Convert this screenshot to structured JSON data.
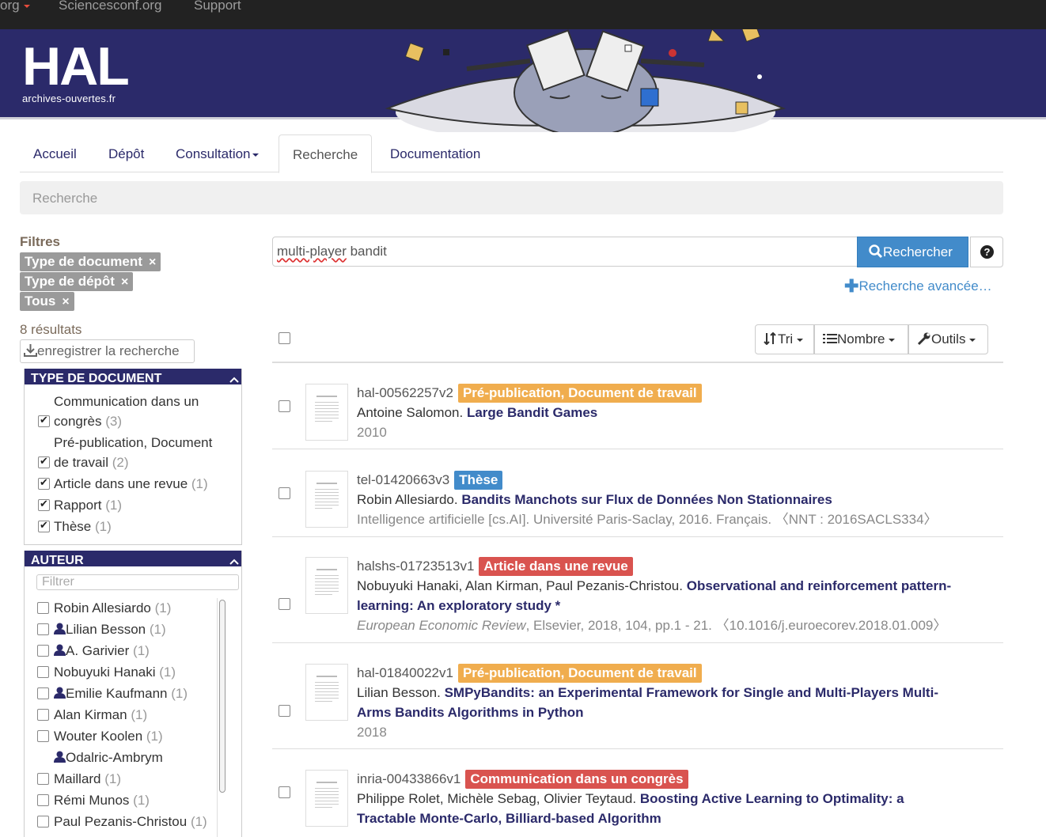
{
  "topbar": {
    "items": [
      {
        "label": "org"
      },
      {
        "label": "Sciencesconf.org"
      },
      {
        "label": "Support"
      }
    ]
  },
  "logo": {
    "title": "HAL",
    "subtitle": "archives-ouvertes.fr"
  },
  "nav": {
    "tabs": [
      {
        "label": "Accueil"
      },
      {
        "label": "Dépôt"
      },
      {
        "label": "Consultation"
      },
      {
        "label": "Recherche"
      },
      {
        "label": "Documentation"
      }
    ]
  },
  "breadcrumb": "Recherche",
  "filters": {
    "title": "Filtres",
    "tags": [
      "Type de document",
      "Type de dépôt",
      "Tous"
    ],
    "close_glyph": "×"
  },
  "results_count": "8 résultats",
  "save_search_label": "enregistrer la recherche",
  "facet_doctype": {
    "title": "TYPE DE DOCUMENT",
    "items": [
      {
        "line1": "Communication dans un",
        "line2": "congrès",
        "count": "(3)",
        "checked": true
      },
      {
        "line1": "Pré-publication, Document",
        "line2": "de travail",
        "count": "(2)",
        "checked": true
      },
      {
        "label": "Article dans une revue",
        "count": "(1)",
        "checked": true
      },
      {
        "label": "Rapport",
        "count": "(1)",
        "checked": true
      },
      {
        "label": "Thèse",
        "count": "(1)",
        "checked": true
      }
    ]
  },
  "facet_author": {
    "title": "AUTEUR",
    "filter_placeholder": "Filtrer",
    "items": [
      {
        "label": "Robin Allesiardo",
        "count": "(1)"
      },
      {
        "label": "Lilian Besson",
        "count": "(1)"
      },
      {
        "label": "A. Garivier",
        "count": "(1)"
      },
      {
        "label": "Nobuyuki Hanaki",
        "count": "(1)"
      },
      {
        "label": "Emilie Kaufmann",
        "count": "(1)"
      },
      {
        "label": "Alan Kirman",
        "count": "(1)"
      },
      {
        "label": "Wouter Koolen",
        "count": "(1)"
      },
      {
        "label": "Odalric-Ambrym",
        "count": ""
      },
      {
        "label": "Maillard",
        "count": "(1)"
      },
      {
        "label": "Rémi Munos",
        "count": "(1)"
      },
      {
        "label": "Paul Pezanis-Christou",
        "count": "(1)"
      }
    ]
  },
  "search": {
    "query_misspelled": "multi-player",
    "query_rest": " bandit",
    "button_label": "Rechercher",
    "help_glyph": "?",
    "advanced_label": "Recherche avancée…"
  },
  "toolbar": {
    "sort_label": "Tri",
    "count_label": "Nombre",
    "tools_label": "Outils"
  },
  "colors": {
    "hal_blue": "#2b2a6a",
    "orange": "#f0ad4e",
    "blue": "#428bca",
    "red": "#d9534f"
  },
  "results": [
    {
      "docid": "hal-00562257v2",
      "badge": "Pré-publication, Document de travail",
      "badge_color": "#f0ad4e",
      "authors": "Antoine Salomon.",
      "title": "Large Bandit Games",
      "meta": "2010"
    },
    {
      "docid": "tel-01420663v3",
      "badge": "Thèse",
      "badge_color": "#428bca",
      "authors": "Robin Allesiardo.",
      "title": "Bandits Manchots sur Flux de Données Non Stationnaires",
      "meta_plain": "Intelligence artificielle [cs.AI]. Université Paris-Saclay, 2016. Français.",
      "meta_link": "〈NNT : 2016SACLS334〉"
    },
    {
      "docid": "halshs-01723513v1",
      "badge": "Article dans une revue",
      "badge_color": "#d9534f",
      "authors": "Nobuyuki Hanaki, Alan Kirman, Paul Pezanis-Christou.",
      "title_part1": "Observational and reinforcement pattern-",
      "title_part2": "learning: An exploratory study *",
      "meta_journal": "European Economic Review",
      "meta_plain": ", Elsevier, 2018, 104, pp.1 - 21.",
      "meta_link": "〈10.1016/j.euroecorev.2018.01.009〉"
    },
    {
      "docid": "hal-01840022v1",
      "badge": "Pré-publication, Document de travail",
      "badge_color": "#f0ad4e",
      "authors": "Lilian Besson.",
      "title_part1": "SMPyBandits: an Experimental Framework for Single and Multi-Players Multi-",
      "title_part2": "Arms Bandits Algorithms in Python",
      "meta": "2018"
    },
    {
      "docid": "inria-00433866v1",
      "badge": "Communication dans un congrès",
      "badge_color": "#d9534f",
      "authors": "Philippe Rolet, Michèle Sebag, Olivier Teytaud.",
      "title_part1": "Boosting Active Learning to Optimality: a",
      "title_part2": "Tractable Monte-Carlo, Billiard-based Algorithm"
    }
  ]
}
